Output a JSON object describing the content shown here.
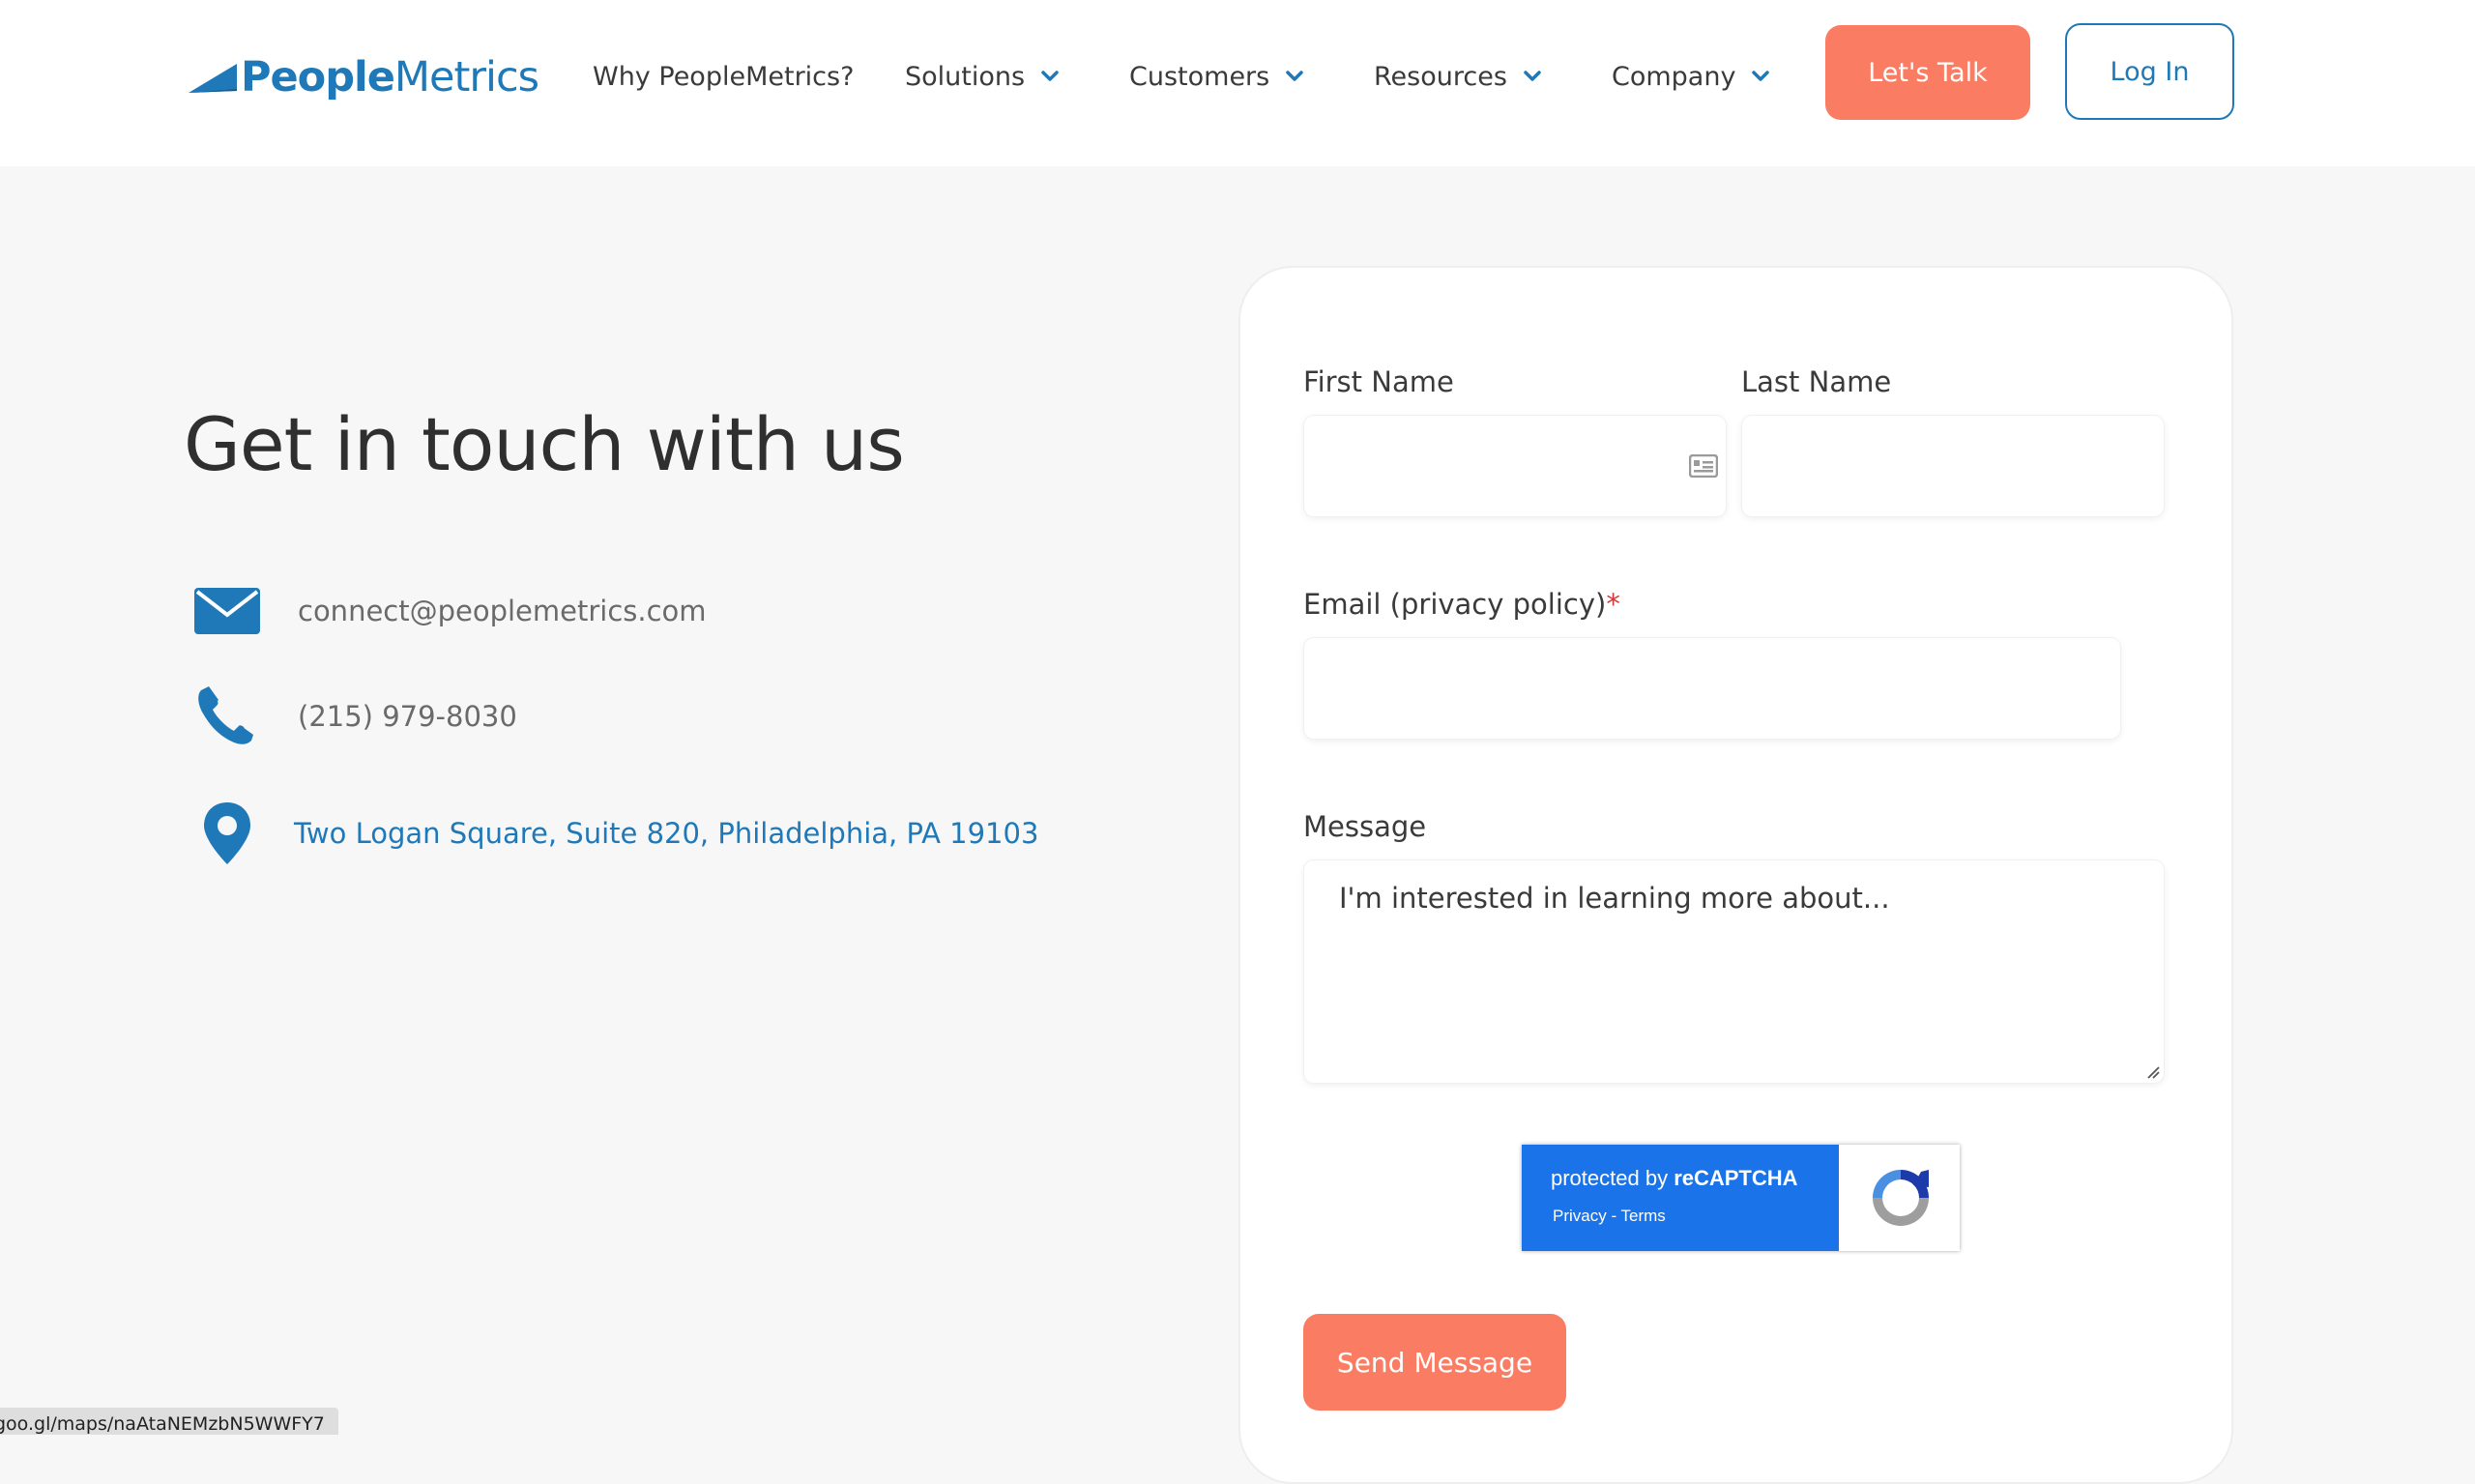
{
  "header": {
    "logo": {
      "bold": "People",
      "light": "Metrics"
    },
    "nav": [
      {
        "label": "Why PeopleMetrics?",
        "has_dropdown": false
      },
      {
        "label": "Solutions",
        "has_dropdown": true
      },
      {
        "label": "Customers",
        "has_dropdown": true
      },
      {
        "label": "Resources",
        "has_dropdown": true
      },
      {
        "label": "Company",
        "has_dropdown": true
      }
    ],
    "cta_label": "Let's Talk",
    "login_label": "Log In"
  },
  "contact": {
    "heading": "Get in touch with us",
    "email": "connect@peoplemetrics.com",
    "phone": "(215) 979-8030",
    "address": "Two Logan Square, Suite 820, Philadelphia, PA 19103",
    "icons": [
      "envelope-icon",
      "phone-icon",
      "map-pin-icon"
    ]
  },
  "form": {
    "first_name_label": "First Name",
    "last_name_label": "Last Name",
    "email_label": "Email (privacy policy)",
    "email_required_mark": "*",
    "message_label": "Message",
    "message_placeholder": "I'm interested in learning more about...",
    "first_name_value": "",
    "last_name_value": "",
    "email_value": "",
    "recaptcha": {
      "line1_prefix": "protected by ",
      "line1_brand": "reCAPTCHA",
      "line2": "Privacy - Terms"
    },
    "submit_label": "Send Message"
  },
  "status_bar": {
    "url": "goo.gl/maps/naAtaNEMzbN5WWFY7"
  },
  "colors": {
    "brand_blue": "#1f79b8",
    "accent_coral": "#fa7d63",
    "page_bg": "#f7f7f8",
    "recaptcha_blue": "#1a73e8"
  }
}
